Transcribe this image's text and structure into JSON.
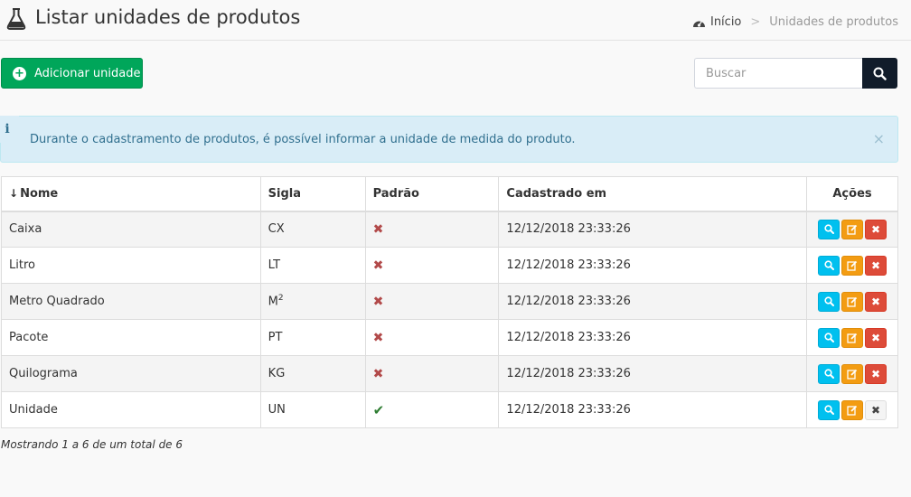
{
  "header": {
    "title": "Listar unidades de produtos",
    "breadcrumb": {
      "home": "Início",
      "separator": ">",
      "current": "Unidades de produtos"
    }
  },
  "toolbar": {
    "add_label": "Adicionar unidade",
    "search_placeholder": "Buscar"
  },
  "callout": {
    "message": "Durante o cadastramento de produtos, é possível informar a unidade de medida do produto.",
    "close": "×"
  },
  "table": {
    "columns": {
      "nome": "Nome",
      "sigla": "Sigla",
      "padrao": "Padrão",
      "cadastrado": "Cadastrado em",
      "acoes": "Ações"
    },
    "rows": [
      {
        "nome": "Caixa",
        "sigla": "CX",
        "sigla_sup": "",
        "padrao": false,
        "cadastrado": "12/12/2018 23:33:26"
      },
      {
        "nome": "Litro",
        "sigla": "LT",
        "sigla_sup": "",
        "padrao": false,
        "cadastrado": "12/12/2018 23:33:26"
      },
      {
        "nome": "Metro Quadrado",
        "sigla": "M",
        "sigla_sup": "2",
        "padrao": false,
        "cadastrado": "12/12/2018 23:33:26"
      },
      {
        "nome": "Pacote",
        "sigla": "PT",
        "sigla_sup": "",
        "padrao": false,
        "cadastrado": "12/12/2018 23:33:26"
      },
      {
        "nome": "Quilograma",
        "sigla": "KG",
        "sigla_sup": "",
        "padrao": false,
        "cadastrado": "12/12/2018 23:33:26"
      },
      {
        "nome": "Unidade",
        "sigla": "UN",
        "sigla_sup": "",
        "padrao": true,
        "cadastrado": "12/12/2018 23:33:26"
      }
    ]
  },
  "footer": {
    "summary": "Mostrando 1 a 6 de um total de 6"
  },
  "icons": {
    "title": "flask-icon",
    "home": "dashboard-icon",
    "add": "plus-circle-icon",
    "search": "search-icon",
    "info": "info-icon",
    "sort": "sort-icon",
    "no": "times-icon",
    "yes": "check-icon",
    "view": "search-icon",
    "edit": "edit-icon",
    "delete": "times-icon"
  },
  "colors": {
    "add_button": "#00a65a",
    "view_button": "#00c0ef",
    "edit_button": "#f39c12",
    "delete_button": "#dd4b39",
    "callout_bg": "#d9edf7",
    "search_button": "#111c2a"
  }
}
